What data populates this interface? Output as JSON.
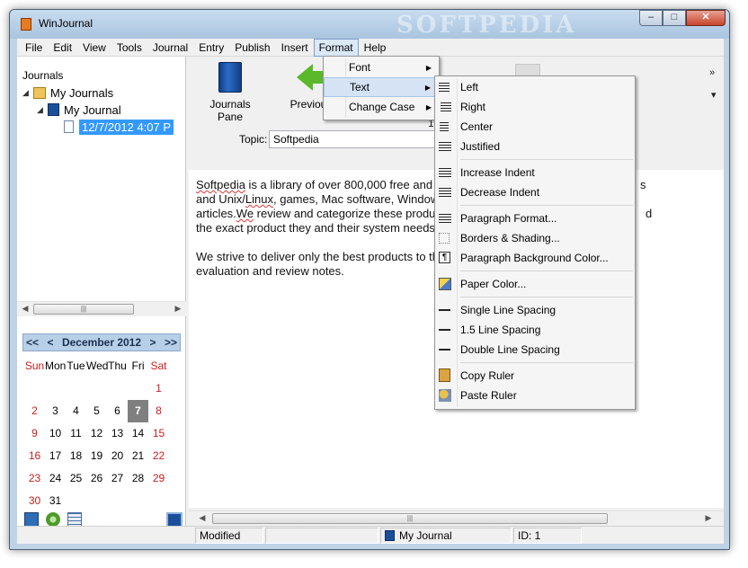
{
  "window": {
    "title": "WinJournal",
    "watermark": "SOFTPEDIA",
    "min": "–",
    "max": "□",
    "close": "✕"
  },
  "menubar": [
    "File",
    "Edit",
    "View",
    "Tools",
    "Journal",
    "Entry",
    "Publish",
    "Insert",
    "Format",
    "Help"
  ],
  "tree": {
    "title": "Journals",
    "root": "My Journals",
    "journal": "My Journal",
    "entry": "12/7/2012 4:07 P"
  },
  "calendar": {
    "nav_prev_year": "<<",
    "nav_prev": "<",
    "month": "December 2012",
    "nav_next": ">",
    "nav_next_year": ">>",
    "weekdays": [
      "Sun",
      "Mon",
      "Tue",
      "Wed",
      "Thu",
      "Fri",
      "Sat"
    ],
    "days": [
      "",
      "",
      "",
      "",
      "",
      "",
      "1",
      "2",
      "3",
      "4",
      "5",
      "6",
      "7",
      "8",
      "9",
      "10",
      "11",
      "12",
      "13",
      "14",
      "15",
      "16",
      "17",
      "18",
      "19",
      "20",
      "21",
      "22",
      "23",
      "24",
      "25",
      "26",
      "27",
      "28",
      "29",
      "30",
      "31",
      "",
      "",
      "",
      "",
      ""
    ],
    "today": "7"
  },
  "toolbar": {
    "journals_pane": "Journals Pane",
    "previous": "Previous",
    "date_fragment": "12/7",
    "topic_label": "Topic:",
    "topic_value": "Softpedia",
    "overflow": "»",
    "dropdown": "▾"
  },
  "editor": {
    "p1_l1_a": "Softpedia",
    "p1_l1_b": " is a library of over 800,000 free and fre",
    "p1_l1_c": "s",
    "p1_l2_a": "and Unix/",
    "p1_l2_b": "Linux",
    "p1_l2_c": ", games, Mac software, Windows",
    "p1_l3_a": "articles.",
    "p1_l3_b": "We",
    "p1_l3_c": " review and categorize these product",
    "p1_l3_d": "d",
    "p1_l4": "the exact product they and their system needs.",
    "p2_l1": "We strive to deliver only the best products to the",
    "p2_l2": "evaluation and review notes."
  },
  "format_menu": {
    "items": [
      {
        "label": "Font",
        "submenu": true
      },
      {
        "label": "Text",
        "submenu": true,
        "highlighted": true
      },
      {
        "label": "Change Case",
        "submenu": true
      }
    ]
  },
  "text_menu": {
    "left": "Left",
    "right": "Right",
    "center": "Center",
    "justified": "Justified",
    "increase_indent": "Increase Indent",
    "decrease_indent": "Decrease Indent",
    "paragraph_format": "Paragraph Format...",
    "borders_shading": "Borders & Shading...",
    "paragraph_bg_color": "Paragraph Background Color...",
    "paper_color": "Paper Color...",
    "single_spacing": "Single Line Spacing",
    "one_half_spacing": "1.5 Line Spacing",
    "double_spacing": "Double Line Spacing",
    "copy_ruler": "Copy Ruler",
    "paste_ruler": "Paste Ruler"
  },
  "statusbar": {
    "state": "Modified",
    "journal": "My Journal",
    "id": "ID: 1"
  },
  "colors": {
    "accent": "#3399ff",
    "weekend": "#c81e1e",
    "calendar_header": "#b8cfe8"
  }
}
